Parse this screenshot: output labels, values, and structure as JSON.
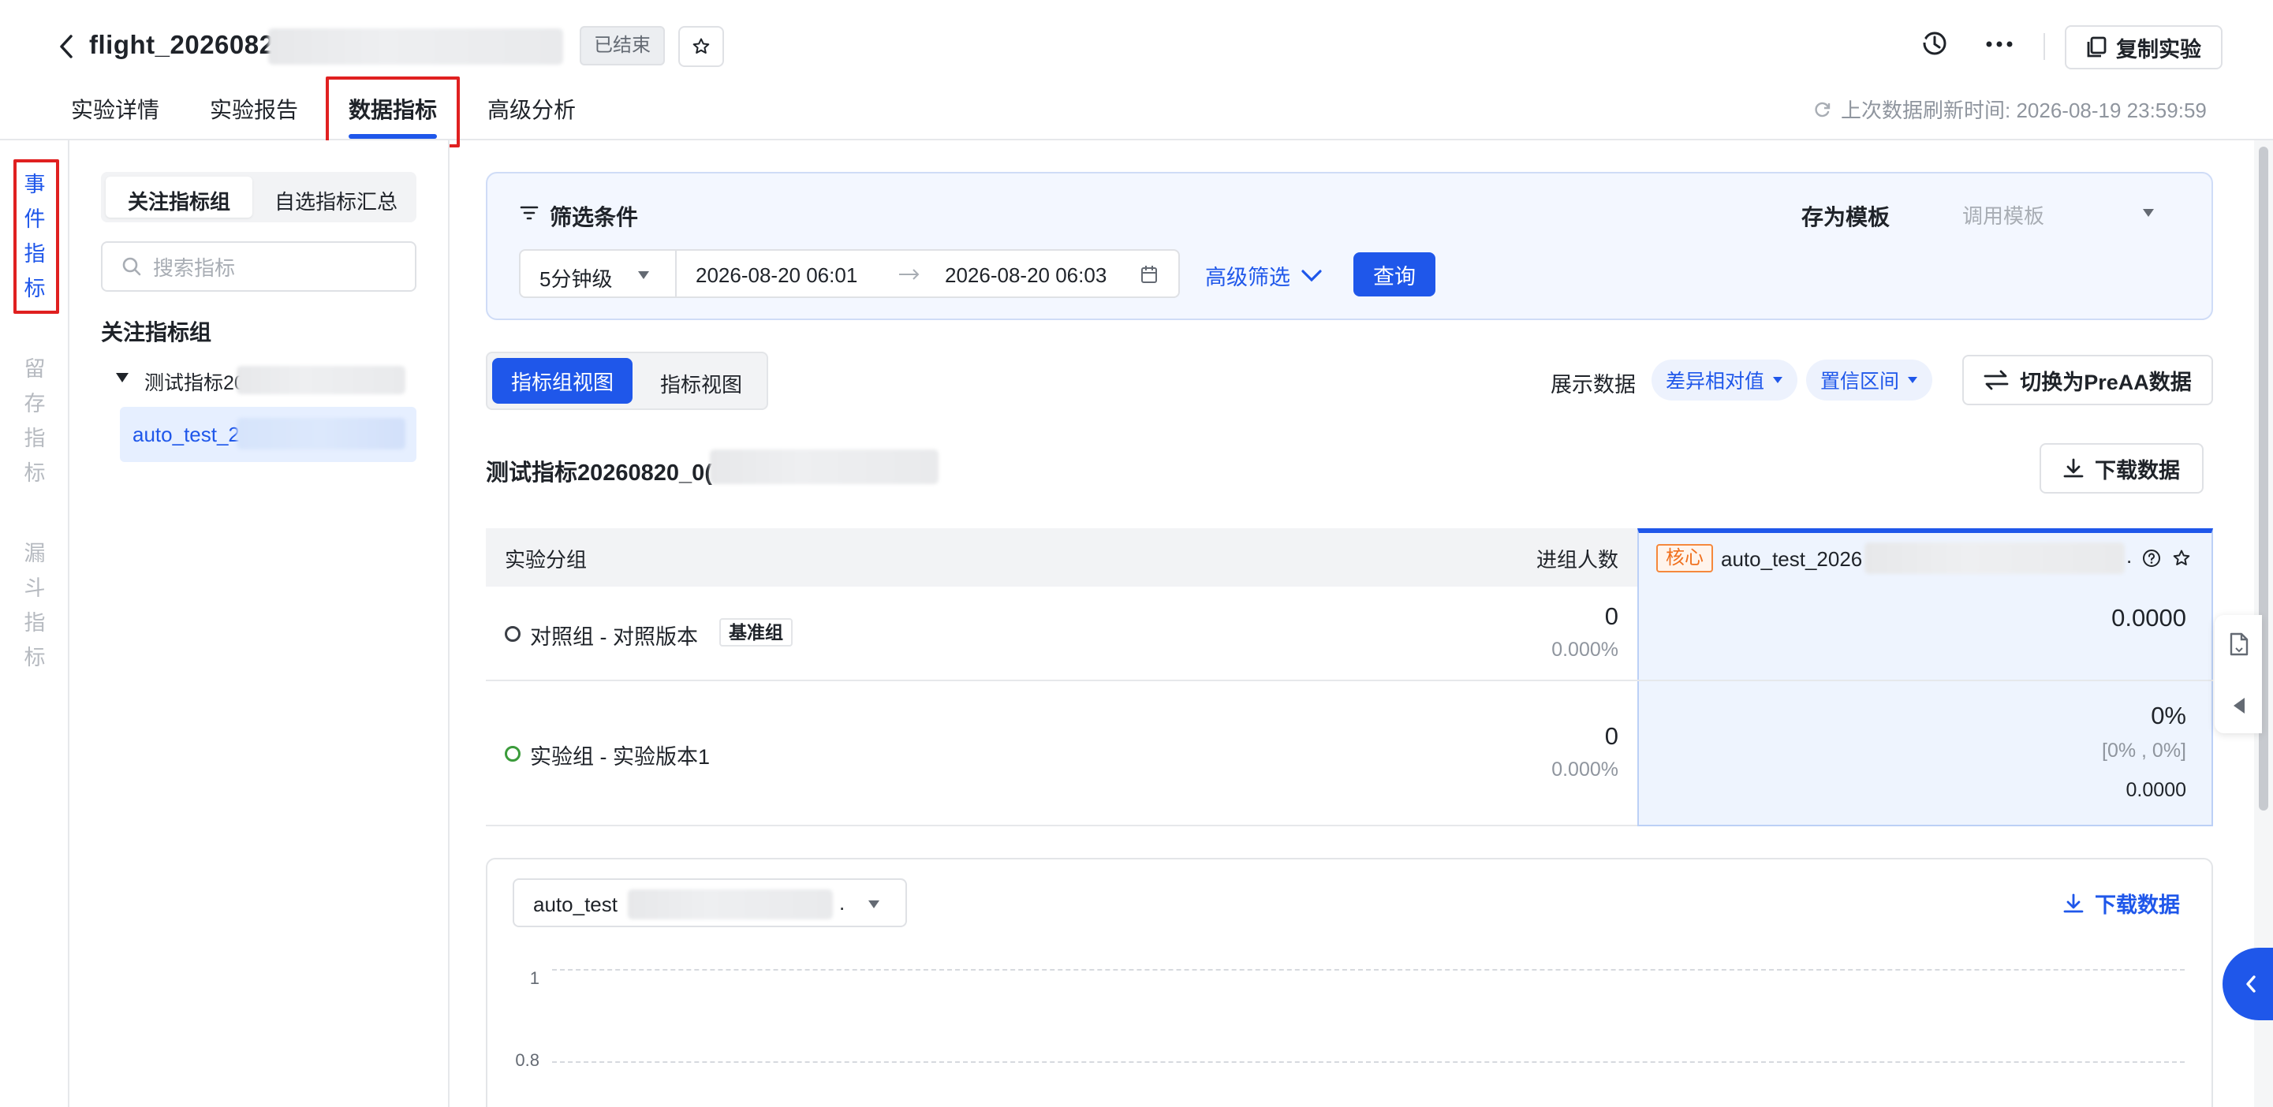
{
  "header": {
    "title": "flight_2026082",
    "status_tag": "已结束",
    "tabs": [
      {
        "label": "实验详情"
      },
      {
        "label": "实验报告"
      },
      {
        "label": "数据指标"
      },
      {
        "label": "高级分析"
      }
    ],
    "copy_button": "复制实验",
    "refresh_text": "上次数据刷新时间:  2026-08-19 23:59:59"
  },
  "rail": {
    "items": [
      {
        "label": "事件指标",
        "chars": [
          "事",
          "件",
          "指",
          "标"
        ]
      },
      {
        "label": "留存指标",
        "chars": [
          "留",
          "存",
          "指",
          "标"
        ]
      },
      {
        "label": "漏斗指标",
        "chars": [
          "漏",
          "斗",
          "指",
          "标"
        ]
      }
    ]
  },
  "sidebar": {
    "segments": [
      "关注指标组",
      "自选指标汇总"
    ],
    "search_placeholder": "搜索指标",
    "section_title": "关注指标组",
    "group_name": "测试指标20",
    "selected_metric": "auto_test_2"
  },
  "filter": {
    "title": "筛选条件",
    "save_template": "存为模板",
    "template_placeholder": "调用模板",
    "granularity": "5分钟级",
    "start_time": "2026-08-20 06:01",
    "end_time": "2026-08-20 06:03",
    "advanced": "高级筛选",
    "query_button": "查询"
  },
  "view": {
    "toggle": [
      "指标组视图",
      "指标视图"
    ],
    "display_label": "展示数据",
    "display_options": [
      "差异相对值",
      "置信区间"
    ],
    "switch_button": "切换为PreAA数据"
  },
  "group_section": {
    "title": "测试指标20260820_0(",
    "download": "下载数据"
  },
  "table": {
    "headers": {
      "group": "实验分组",
      "count": "进组人数"
    },
    "core_tag": "核心",
    "core_metric": "auto_test_2026",
    "rows": [
      {
        "name": "对照组 - 对照版本",
        "tag": "基准组",
        "count": "0",
        "pct": "0.000%",
        "value": "0.0000",
        "ci": "",
        "abs": ""
      },
      {
        "name": "实验组 - 实验版本1",
        "tag": "",
        "count": "0",
        "pct": "0.000%",
        "value": "0%",
        "ci": "[0% , 0%]",
        "abs": "0.0000"
      }
    ]
  },
  "chart": {
    "metric_select": "auto_test",
    "download": "下载数据",
    "y_ticks": [
      "1",
      "0.8"
    ]
  },
  "colors": {
    "primary": "#1f57ea",
    "control_dot": "#3b3f46",
    "treatment_dot": "#3b9b3b",
    "highlight_border": "#e02020",
    "core_tag": "#f0701e"
  }
}
